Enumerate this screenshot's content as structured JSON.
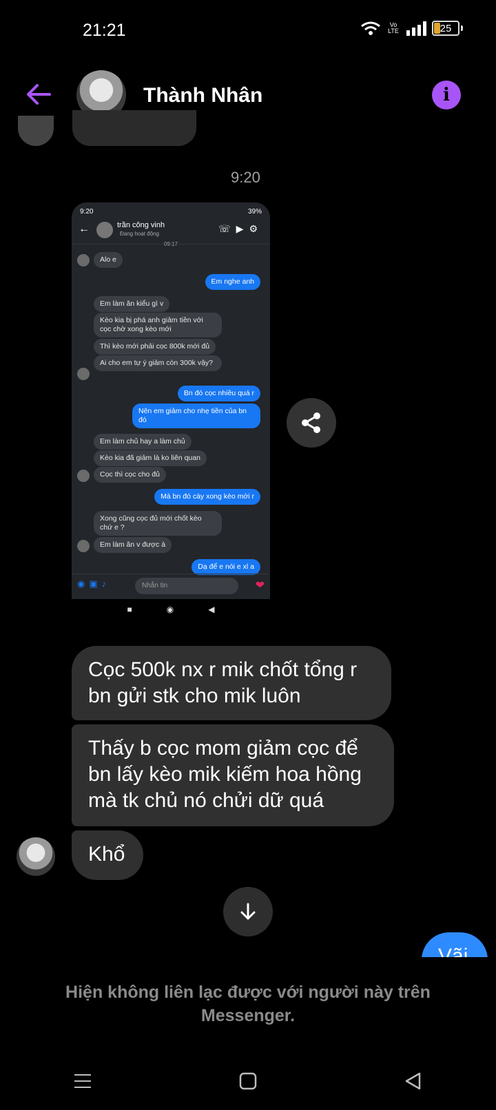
{
  "status_bar": {
    "time": "21:21",
    "battery": "25",
    "network": "Vo LTE"
  },
  "header": {
    "contact_name": "Thành Nhân"
  },
  "timestamp": "9:20",
  "embedded_screenshot": {
    "status_time": "9:20",
    "status_right": "39%",
    "contact_name": "trần công vinh",
    "contact_status": "Đang hoạt động",
    "time_divider": "09:17",
    "input_placeholder": "Nhắn tin",
    "messages": [
      {
        "side": "left",
        "text": "Alo e"
      },
      {
        "side": "right",
        "text": "Em nghe anh"
      },
      {
        "side": "left",
        "text": "Em làm ăn kiểu gì v"
      },
      {
        "side": "left",
        "text": "Kèo kia bị phá anh giảm tiền với cọc chờ xong kèo mới"
      },
      {
        "side": "left",
        "text": "Thì kèo mới phải cọc 800k mới đủ"
      },
      {
        "side": "left",
        "text": "Ai cho em tự ý giảm còn 300k vậy?"
      },
      {
        "side": "right",
        "text": "Bn đó cọc nhiều quá r"
      },
      {
        "side": "right",
        "text": "Nên em giảm cho nhẹ tiền của bn đó"
      },
      {
        "side": "left",
        "text": "Em làm chủ hay a làm chủ"
      },
      {
        "side": "left",
        "text": "Kèo kia đã giảm là ko liên quan"
      },
      {
        "side": "left",
        "text": "Cọc thì cọc cho đủ"
      },
      {
        "side": "right",
        "text": "Mà bn đó cày xong kèo mới r"
      },
      {
        "side": "left",
        "text": "Xong cũng cọc đủ mới chốt kèo chứ e ?"
      },
      {
        "side": "left",
        "text": "Em làm ăn v được à"
      },
      {
        "side": "right",
        "text": "Dạ để e nói e xl a"
      }
    ]
  },
  "messages": [
    {
      "text": "Cọc 500k nx r mik chốt tổng r bn gửi stk cho mik luôn"
    },
    {
      "text": "Thấy b cọc mom giảm cọc để bn lấy kèo mik kiếm hoa hồng mà tk chủ nó chửi dữ quá"
    },
    {
      "text": "Khổ"
    }
  ],
  "my_partial_message": "Vãi",
  "notice": "Hiện không liên lạc được với người này trên Messenger.",
  "colors": {
    "accent": "#a855f7",
    "incoming_bubble": "#303030",
    "outgoing_bubble": "#2e8bff"
  }
}
